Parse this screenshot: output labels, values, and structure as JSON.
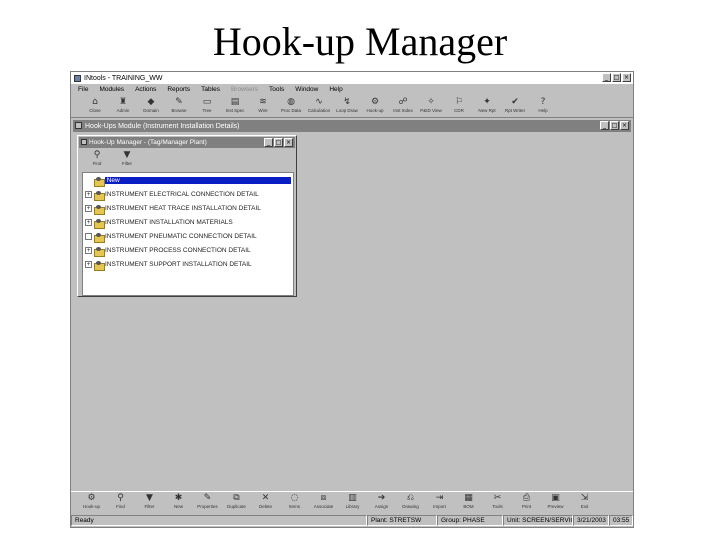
{
  "slide": {
    "title": "Hook-up Manager"
  },
  "app": {
    "title": "INtools - TRAINING_WW",
    "window_buttons": [
      "_",
      "□",
      "×"
    ],
    "menu": [
      {
        "label": "File",
        "dim": false
      },
      {
        "label": "Modules",
        "dim": false
      },
      {
        "label": "Actions",
        "dim": false
      },
      {
        "label": "Reports",
        "dim": false
      },
      {
        "label": "Tables",
        "dim": false
      },
      {
        "label": "Browsers",
        "dim": true
      },
      {
        "label": "Tools",
        "dim": false
      },
      {
        "label": "Window",
        "dim": false
      },
      {
        "label": "Help",
        "dim": false
      }
    ],
    "toolbar": [
      {
        "label": "Close",
        "icon": "⌂"
      },
      {
        "label": "Admin",
        "icon": "♜"
      },
      {
        "label": "Domain",
        "icon": "◆"
      },
      {
        "label": "Browse",
        "icon": "✎"
      },
      {
        "label": "Tree",
        "icon": "▭"
      },
      {
        "label": "Inst Spec",
        "icon": "▤"
      },
      {
        "label": "Wire",
        "icon": "≋"
      },
      {
        "label": "Proc Data",
        "icon": "◍"
      },
      {
        "label": "Calculation",
        "icon": "∿"
      },
      {
        "label": "Loop Draw",
        "icon": "↯"
      },
      {
        "label": "Hook-up",
        "icon": "⚙"
      },
      {
        "label": "Inst Index",
        "icon": "☍"
      },
      {
        "label": "P&ID View",
        "icon": "✧"
      },
      {
        "label": "CDR",
        "icon": "⚐"
      },
      {
        "label": "New Rpt",
        "icon": "✦"
      },
      {
        "label": "Rpt Writer",
        "icon": "✔"
      },
      {
        "label": "Help",
        "icon": "?"
      }
    ],
    "child_window": {
      "title": "Hook-Ups Module (Instrument Installation Details)"
    },
    "hookup_manager": {
      "title": "Hook-Up Manager - (Tag/Manager Plant)",
      "tools": [
        {
          "label": "Find",
          "icon": "⚲"
        },
        {
          "label": "Filter",
          "icon": "▼"
        }
      ],
      "tree": [
        {
          "label": "New",
          "expander": "",
          "selected": true
        },
        {
          "label": "INSTRUMENT ELECTRICAL CONNECTION DETAIL",
          "expander": "+",
          "selected": false
        },
        {
          "label": "INSTRUMENT HEAT TRACE INSTALLATION DETAIL",
          "expander": "+",
          "selected": false
        },
        {
          "label": "INSTRUMENT INSTALLATION MATERIALS",
          "expander": "+",
          "selected": false
        },
        {
          "label": "INSTRUMENT PNEUMATIC CONNECTION DETAIL",
          "expander": "",
          "selected": false
        },
        {
          "label": "INSTRUMENT PROCESS CONNECTION DETAIL",
          "expander": "+",
          "selected": false
        },
        {
          "label": "INSTRUMENT SUPPORT INSTALLATION DETAIL",
          "expander": "+",
          "selected": false
        }
      ]
    },
    "bottom_toolbar": [
      {
        "label": "Hook-up",
        "icon": "⚙"
      },
      {
        "label": "Find",
        "icon": "⚲"
      },
      {
        "label": "Filter",
        "icon": "▼"
      },
      {
        "label": "New",
        "icon": "✱"
      },
      {
        "label": "Properties",
        "icon": "✎"
      },
      {
        "label": "Duplicate",
        "icon": "⧉"
      },
      {
        "label": "Delete",
        "icon": "✕"
      },
      {
        "label": "Items",
        "icon": "◌"
      },
      {
        "label": "Associate",
        "icon": "⧈"
      },
      {
        "label": "Library",
        "icon": "▥"
      },
      {
        "label": "Assign",
        "icon": "➔"
      },
      {
        "label": "Drawing",
        "icon": "⎌"
      },
      {
        "label": "Import",
        "icon": "⇥"
      },
      {
        "label": "BOM",
        "icon": "▦"
      },
      {
        "label": "Tools",
        "icon": "✂"
      },
      {
        "label": "Print",
        "icon": "⎙"
      },
      {
        "label": "Preview",
        "icon": "▣"
      },
      {
        "label": "Exit",
        "icon": "⇲"
      }
    ],
    "status": {
      "ready": "Ready",
      "plant": "Plant: STRETSW",
      "area": "Group: PHASE",
      "unit": "Unit: SCREEN/SERVICE",
      "date": "3/21/2003",
      "time": "03:55"
    }
  }
}
